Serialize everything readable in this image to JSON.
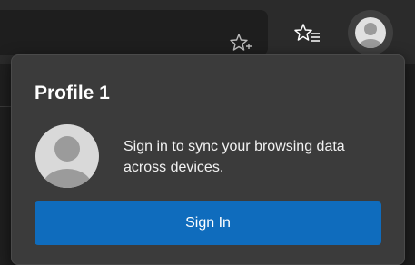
{
  "toolbar": {
    "favorite_icon": "star-plus-icon",
    "favorites_icon": "star-list-icon",
    "profile_icon": "profile-avatar-icon"
  },
  "profile_flyout": {
    "profile_name": "Profile 1",
    "sync_message": "Sign in to sync your browsing data across devices.",
    "sign_in_label": "Sign In",
    "avatar_icon": "profile-avatar-icon"
  },
  "colors": {
    "primary_button": "#0f6cbd",
    "flyout_background": "#3b3b3b",
    "toolbar_background": "#2b2b2b"
  }
}
